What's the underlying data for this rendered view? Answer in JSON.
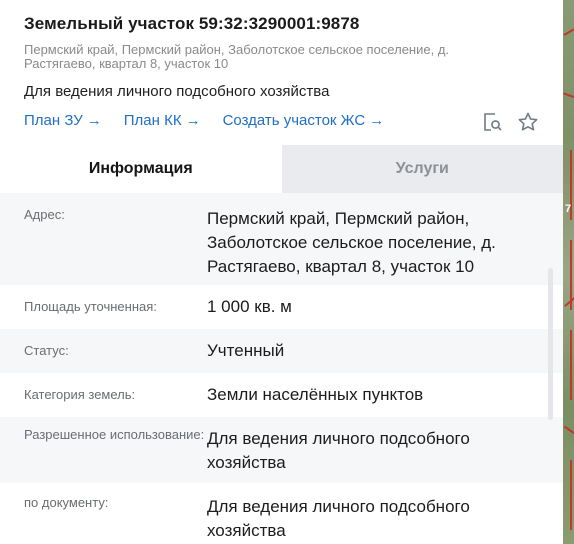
{
  "parcel": {
    "title": "Земельный участок 59:32:3290001:9878",
    "address": "Пермский край, Пермский район, Заболотское сельское поселение, д. Растягаево, квартал 8, участок 10",
    "purpose": "Для ведения личного подсобного хозяйства"
  },
  "links": [
    {
      "label": "План ЗУ",
      "arrow": "→"
    },
    {
      "label": "План КК",
      "arrow": "→"
    },
    {
      "label": "Создать участок ЖС",
      "arrow": "→"
    }
  ],
  "icons": {
    "search_doc": "search-document-icon",
    "favorite": "star-icon"
  },
  "tabs": [
    {
      "label": "Информация",
      "active": true
    },
    {
      "label": "Услуги",
      "active": false
    }
  ],
  "info": [
    {
      "key": "Адрес:",
      "value": "Пермский край, Пермский район, Заболотское сельское поселение, д. Растягаево, квартал 8, участок 10"
    },
    {
      "key": "Площадь уточненная:",
      "value": "1 000 кв. м"
    },
    {
      "key": "Статус:",
      "value": "Учтенный"
    },
    {
      "key": "Категория земель:",
      "value": "Земли населённых пунктов"
    },
    {
      "key": "Разрешенное использование:",
      "value": "Для ведения личного подсобного хозяйства"
    },
    {
      "key": "по документу:",
      "value": "Для ведения личного подсобного хозяйства"
    }
  ],
  "map": {
    "label": "7"
  },
  "colors": {
    "link": "#1f6fc5",
    "inactive_tab": "#e9ebee",
    "row_shade": "#f6f7f9"
  }
}
